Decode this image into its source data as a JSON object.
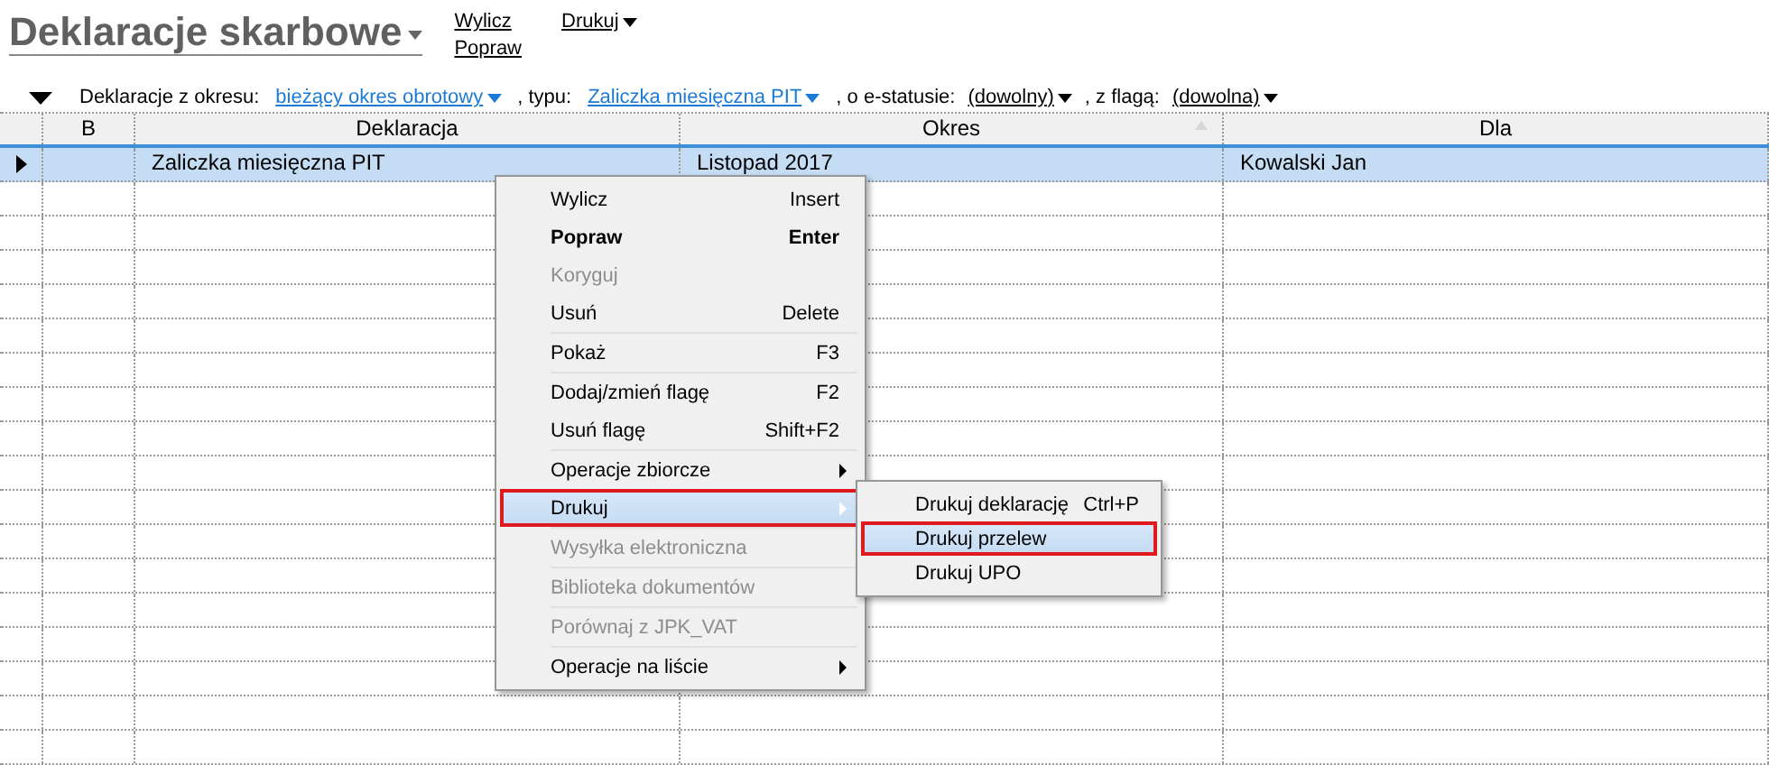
{
  "title": "Deklaracje skarbowe",
  "actions": [
    {
      "label": "Wylicz",
      "dropdown": false
    },
    {
      "label": "Popraw",
      "dropdown": false
    },
    {
      "label": "Drukuj",
      "dropdown": true
    }
  ],
  "filters": [
    {
      "kind": "text",
      "label": "Deklaracje z okresu:"
    },
    {
      "kind": "link",
      "label": "bieżący okres obrotowy"
    },
    {
      "kind": "text",
      "label": ", typu:"
    },
    {
      "kind": "link",
      "label": "Zaliczka miesięczna PIT"
    },
    {
      "kind": "text",
      "label": ", o e-statusie:"
    },
    {
      "kind": "choice",
      "label": "(dowolny)"
    },
    {
      "kind": "text",
      "label": ", z flagą:"
    },
    {
      "kind": "choice",
      "label": "(dowolna)"
    }
  ],
  "table": {
    "columns": [
      {
        "label": "B",
        "sorted": false
      },
      {
        "label": "Deklaracja",
        "sorted": false
      },
      {
        "label": "Okres",
        "sorted": true
      },
      {
        "label": "Dla",
        "sorted": false
      }
    ],
    "rows": [
      {
        "selected": true,
        "cells": [
          "",
          "Zaliczka miesięczna PIT",
          "Listopad 2017",
          "Kowalski Jan"
        ]
      }
    ]
  },
  "context_menu": {
    "groups": [
      [
        {
          "label": "Wylicz",
          "shortcut": "Insert",
          "bold": false,
          "disabled": false,
          "submenu": false,
          "selected": false
        },
        {
          "label": "Popraw",
          "shortcut": "Enter",
          "bold": true,
          "disabled": false,
          "submenu": false,
          "selected": false
        },
        {
          "label": "Koryguj",
          "bold": false,
          "disabled": true,
          "submenu": false,
          "selected": false
        },
        {
          "label": "Usuń",
          "shortcut": "Delete",
          "bold": false,
          "disabled": false,
          "submenu": false,
          "selected": false
        }
      ],
      [
        {
          "label": "Pokaż",
          "shortcut": "F3",
          "bold": false,
          "disabled": false,
          "submenu": false,
          "selected": false
        }
      ],
      [
        {
          "label": "Dodaj/zmień flagę",
          "shortcut": "F2",
          "bold": false,
          "disabled": false,
          "submenu": false,
          "selected": false
        },
        {
          "label": "Usuń flagę",
          "shortcut": "Shift+F2",
          "bold": false,
          "disabled": false,
          "submenu": false,
          "selected": false
        }
      ],
      [
        {
          "label": "Operacje zbiorcze",
          "bold": false,
          "disabled": false,
          "submenu": true,
          "selected": false
        },
        {
          "label": "Drukuj",
          "bold": false,
          "disabled": false,
          "submenu": true,
          "selected": true
        }
      ],
      [
        {
          "label": "Wysyłka elektroniczna",
          "bold": false,
          "disabled": true,
          "submenu": false,
          "selected": false
        }
      ],
      [
        {
          "label": "Biblioteka dokumentów",
          "bold": false,
          "disabled": true,
          "submenu": false,
          "selected": false
        }
      ],
      [
        {
          "label": "Porównaj z JPK_VAT",
          "bold": false,
          "disabled": true,
          "submenu": false,
          "selected": false
        }
      ],
      [
        {
          "label": "Operacje na liście",
          "bold": false,
          "disabled": false,
          "submenu": true,
          "selected": false
        }
      ]
    ]
  },
  "submenu": {
    "items": [
      {
        "label": "Drukuj deklarację",
        "shortcut": "Ctrl+P",
        "selected": false
      },
      {
        "label": "Drukuj przelew",
        "selected": true
      },
      {
        "label": "Drukuj UPO",
        "selected": false
      }
    ]
  }
}
